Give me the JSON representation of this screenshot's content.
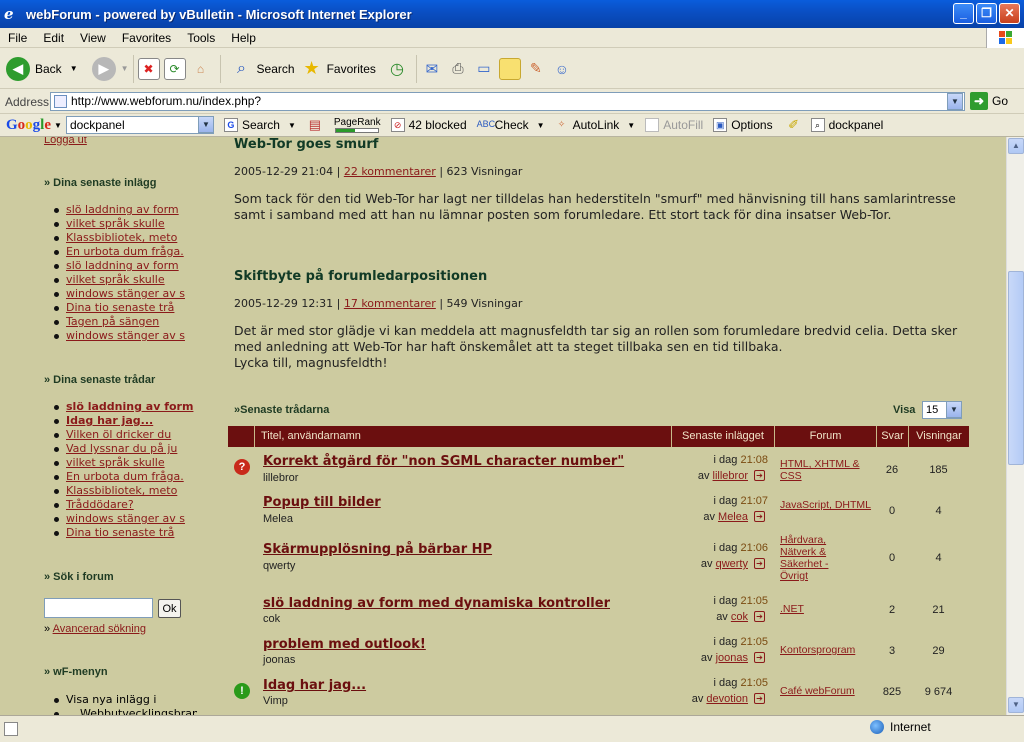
{
  "window": {
    "title": "webForum - powered by vBulletin - Microsoft Internet Explorer"
  },
  "menu": [
    "File",
    "Edit",
    "View",
    "Favorites",
    "Tools",
    "Help"
  ],
  "toolbar": {
    "back": "Back",
    "search": "Search",
    "favorites": "Favorites"
  },
  "address": {
    "label": "Address",
    "url": "http://www.webforum.nu/index.php?",
    "go": "Go"
  },
  "googlebar": {
    "logo": "Google",
    "query": "dockpanel",
    "search": "Search",
    "pagerank": "PageRank",
    "blocked": "42 blocked",
    "check": "Check",
    "autolink": "AutoLink",
    "autofill": "AutoFill",
    "options": "Options",
    "highlight": "dockpanel"
  },
  "sidebar": {
    "logout": "Logga ut",
    "my_posts_title": "» Dina senaste inlägg",
    "my_posts": [
      "slö laddning av form",
      "vilket språk skulle",
      "Klassbibliotek, meto",
      "En urbota dum fråga.",
      "slö laddning av form",
      "vilket språk skulle",
      "windows stänger av s",
      "Dina tio senaste trå",
      "Tagen på sängen",
      "windows stänger av s"
    ],
    "my_threads_title": "» Dina senaste trådar",
    "my_threads": [
      "slö laddning av form",
      "Idag har jag...",
      "Vilken öl dricker du",
      "Vad lyssnar du på ju",
      "vilket språk skulle",
      "En urbota dum fråga.",
      "Klassbibliotek, meto",
      "Tråddödare?",
      "windows stänger av s",
      "Dina tio senaste trå"
    ],
    "search_title": "» Sök i forum",
    "search_btn": "Ok",
    "advanced_prefix": "»",
    "advanced": "Avancerad sökning",
    "wf_title": "» wF-menyn",
    "wf_items": [
      "Visa nya inlägg i",
      "Webbutvecklingsbranschen"
    ]
  },
  "news": [
    {
      "title": "Web-Tor goes smurf",
      "date": "2005-12-29 21:04",
      "comments": "22 kommentarer",
      "views": "623 Visningar",
      "body": "Som tack för den tid Web-Tor har lagt ner tilldelas han hederstiteln \"smurf\" med hänvisning till hans samlarintresse samt i samband med att han nu lämnar posten som forumledare. Ett stort tack för dina insatser Web-Tor."
    },
    {
      "title": "Skiftbyte på forumledarpositionen",
      "date": "2005-12-29 12:31",
      "comments": "17 kommentarer",
      "views": "549 Visningar",
      "body1": "Det är med stor glädje vi kan meddela att magnusfeldth tar sig an rollen som forumledare bredvid celia. Detta sker med anledning att Web-Tor har haft önskemålet att ta steget tillbaka sen en tid tillbaka.",
      "body2": "Lycka till, magnusfeldth!"
    }
  ],
  "threads": {
    "title": "»Senaste trådarna",
    "visa_label": "Visa",
    "visa_value": "15",
    "headers": [
      "Titel, användarnamn",
      "Senaste inlägget",
      "Forum",
      "Svar",
      "Visningar"
    ],
    "rows": [
      {
        "title": "Korrekt åtgärd för \"non SGML character number\"",
        "user": "lillebror",
        "day": "i dag",
        "time": "21:08",
        "by_prefix": "av",
        "by": "lillebror",
        "forum": "HTML, XHTML & CSS",
        "replies": "26",
        "views": "185",
        "icon": "question-icon"
      },
      {
        "title": "Popup till bilder",
        "user": "Melea",
        "day": "i dag",
        "time": "21:07",
        "by_prefix": "av",
        "by": "Melea",
        "forum": "JavaScript, DHTML",
        "replies": "0",
        "views": "4",
        "icon": ""
      },
      {
        "title": "Skärmupplösning på bärbar HP",
        "user": "qwerty",
        "day": "i dag",
        "time": "21:06",
        "by_prefix": "av",
        "by": "qwerty",
        "forum": "Hårdvara, Nätverk & Säkerhet - Övrigt",
        "replies": "0",
        "views": "4",
        "icon": ""
      },
      {
        "title": "slö laddning av form med dynamiska kontroller",
        "user": "cok",
        "day": "i dag",
        "time": "21:05",
        "by_prefix": "av",
        "by": "cok",
        "forum": ".NET",
        "replies": "2",
        "views": "21",
        "icon": ""
      },
      {
        "title": "problem med outlook!",
        "user": "joonas",
        "day": "i dag",
        "time": "21:05",
        "by_prefix": "av",
        "by": "joonas",
        "forum": "Kontorsprogram",
        "replies": "3",
        "views": "29",
        "icon": ""
      },
      {
        "title": "Idag har jag...",
        "user": "Vimp",
        "day": "i dag",
        "time": "21:05",
        "by_prefix": "av",
        "by": "devotion",
        "forum": "Café webForum",
        "replies": "825",
        "views": "9 674",
        "icon": "exclamation-icon"
      }
    ]
  },
  "status": {
    "zone": "Internet"
  },
  "colors": {
    "page_bg": "#cdcba0",
    "header_bg": "#6b0f0f",
    "link": "#8b1a1a",
    "title_text": "#113a26"
  }
}
